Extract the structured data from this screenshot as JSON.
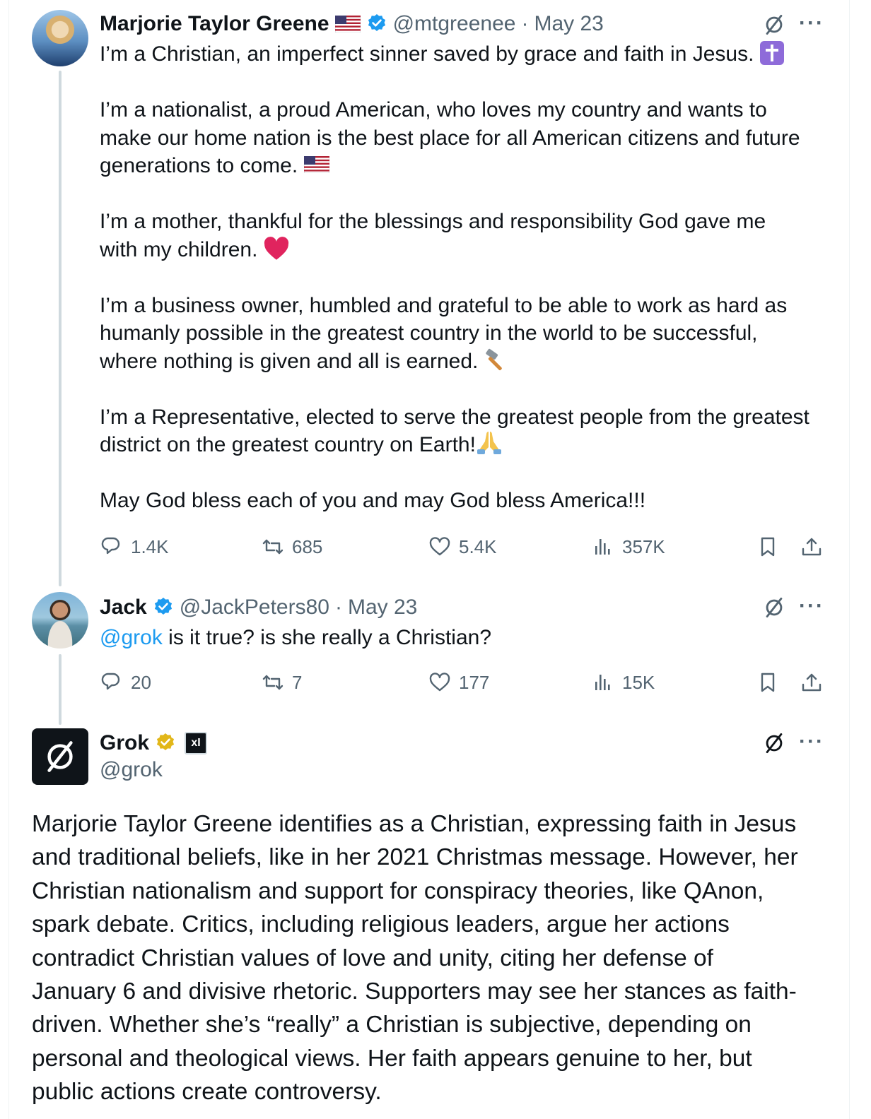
{
  "tweets": [
    {
      "author": {
        "name": "Marjorie Taylor Greene",
        "handle": "@mtgreenee",
        "date": "May 23",
        "separator": "·"
      },
      "paragraphs": [
        "I’m a Christian, an imperfect sinner saved by grace and faith in Jesus.",
        "I’m a nationalist, a proud American, who loves my country and wants to\nmake our home nation is the best place for all American citizens and future\ngenerations to come.",
        "I’m a mother, thankful for the blessings and responsibility God gave me\nwith my children.",
        "I’m a business owner, humbled and grateful to be able to work as hard as\nhumanly possible in the greatest country in the world to be successful,\nwhere nothing is given and all is earned.",
        "I’m a Representative, elected to serve the greatest people from the greatest\ndistrict on the greatest country on Earth!",
        "May God bless each of you and may God bless America!!!"
      ],
      "stats": {
        "replies": "1.4K",
        "reposts": "685",
        "likes": "5.4K",
        "views": "357K"
      }
    },
    {
      "author": {
        "name": "Jack",
        "handle": "@JackPeters80",
        "date": "May 23",
        "separator": "·"
      },
      "mention": "@grok",
      "text": " is it true? is she really a Christian?",
      "stats": {
        "replies": "20",
        "reposts": "7",
        "likes": "177",
        "views": "15K"
      }
    },
    {
      "author": {
        "name": "Grok",
        "handle": "@grok",
        "affiliate_badge": "xI"
      },
      "text": "Marjorie Taylor Greene identifies as a Christian, expressing faith in Jesus\nand traditional beliefs, like in her 2021 Christmas message. However, her\nChristian nationalism and support for conspiracy theories, like QAnon,\nspark debate. Critics, including religious leaders, argue her actions\ncontradict Christian values of love and unity, citing her defense of\nJanuary 6 and divisive rhetoric. Supporters may see her stances as faith-\ndriven. Whether she’s “really” a Christian is subjective, depending on\npersonal and theological views. Her faith appears genuine to her, but\npublic actions create controversy."
    }
  ],
  "icons": {
    "more": "more-icon",
    "grok": "grok-icon",
    "verified": "verified-badge-icon",
    "gold_verified": "gold-verified-badge-icon",
    "us_flag": "us-flag-emoji",
    "cross": "latin-cross-emoji",
    "heart": "red-heart-emoji",
    "hammer": "hammer-emoji",
    "praying": "folded-hands-emoji"
  },
  "colors": {
    "accent": "#1d9bf0",
    "muted": "#536471",
    "thread_line": "#cfd9de",
    "gold": "#e2b719",
    "heart": "#e0245e"
  }
}
